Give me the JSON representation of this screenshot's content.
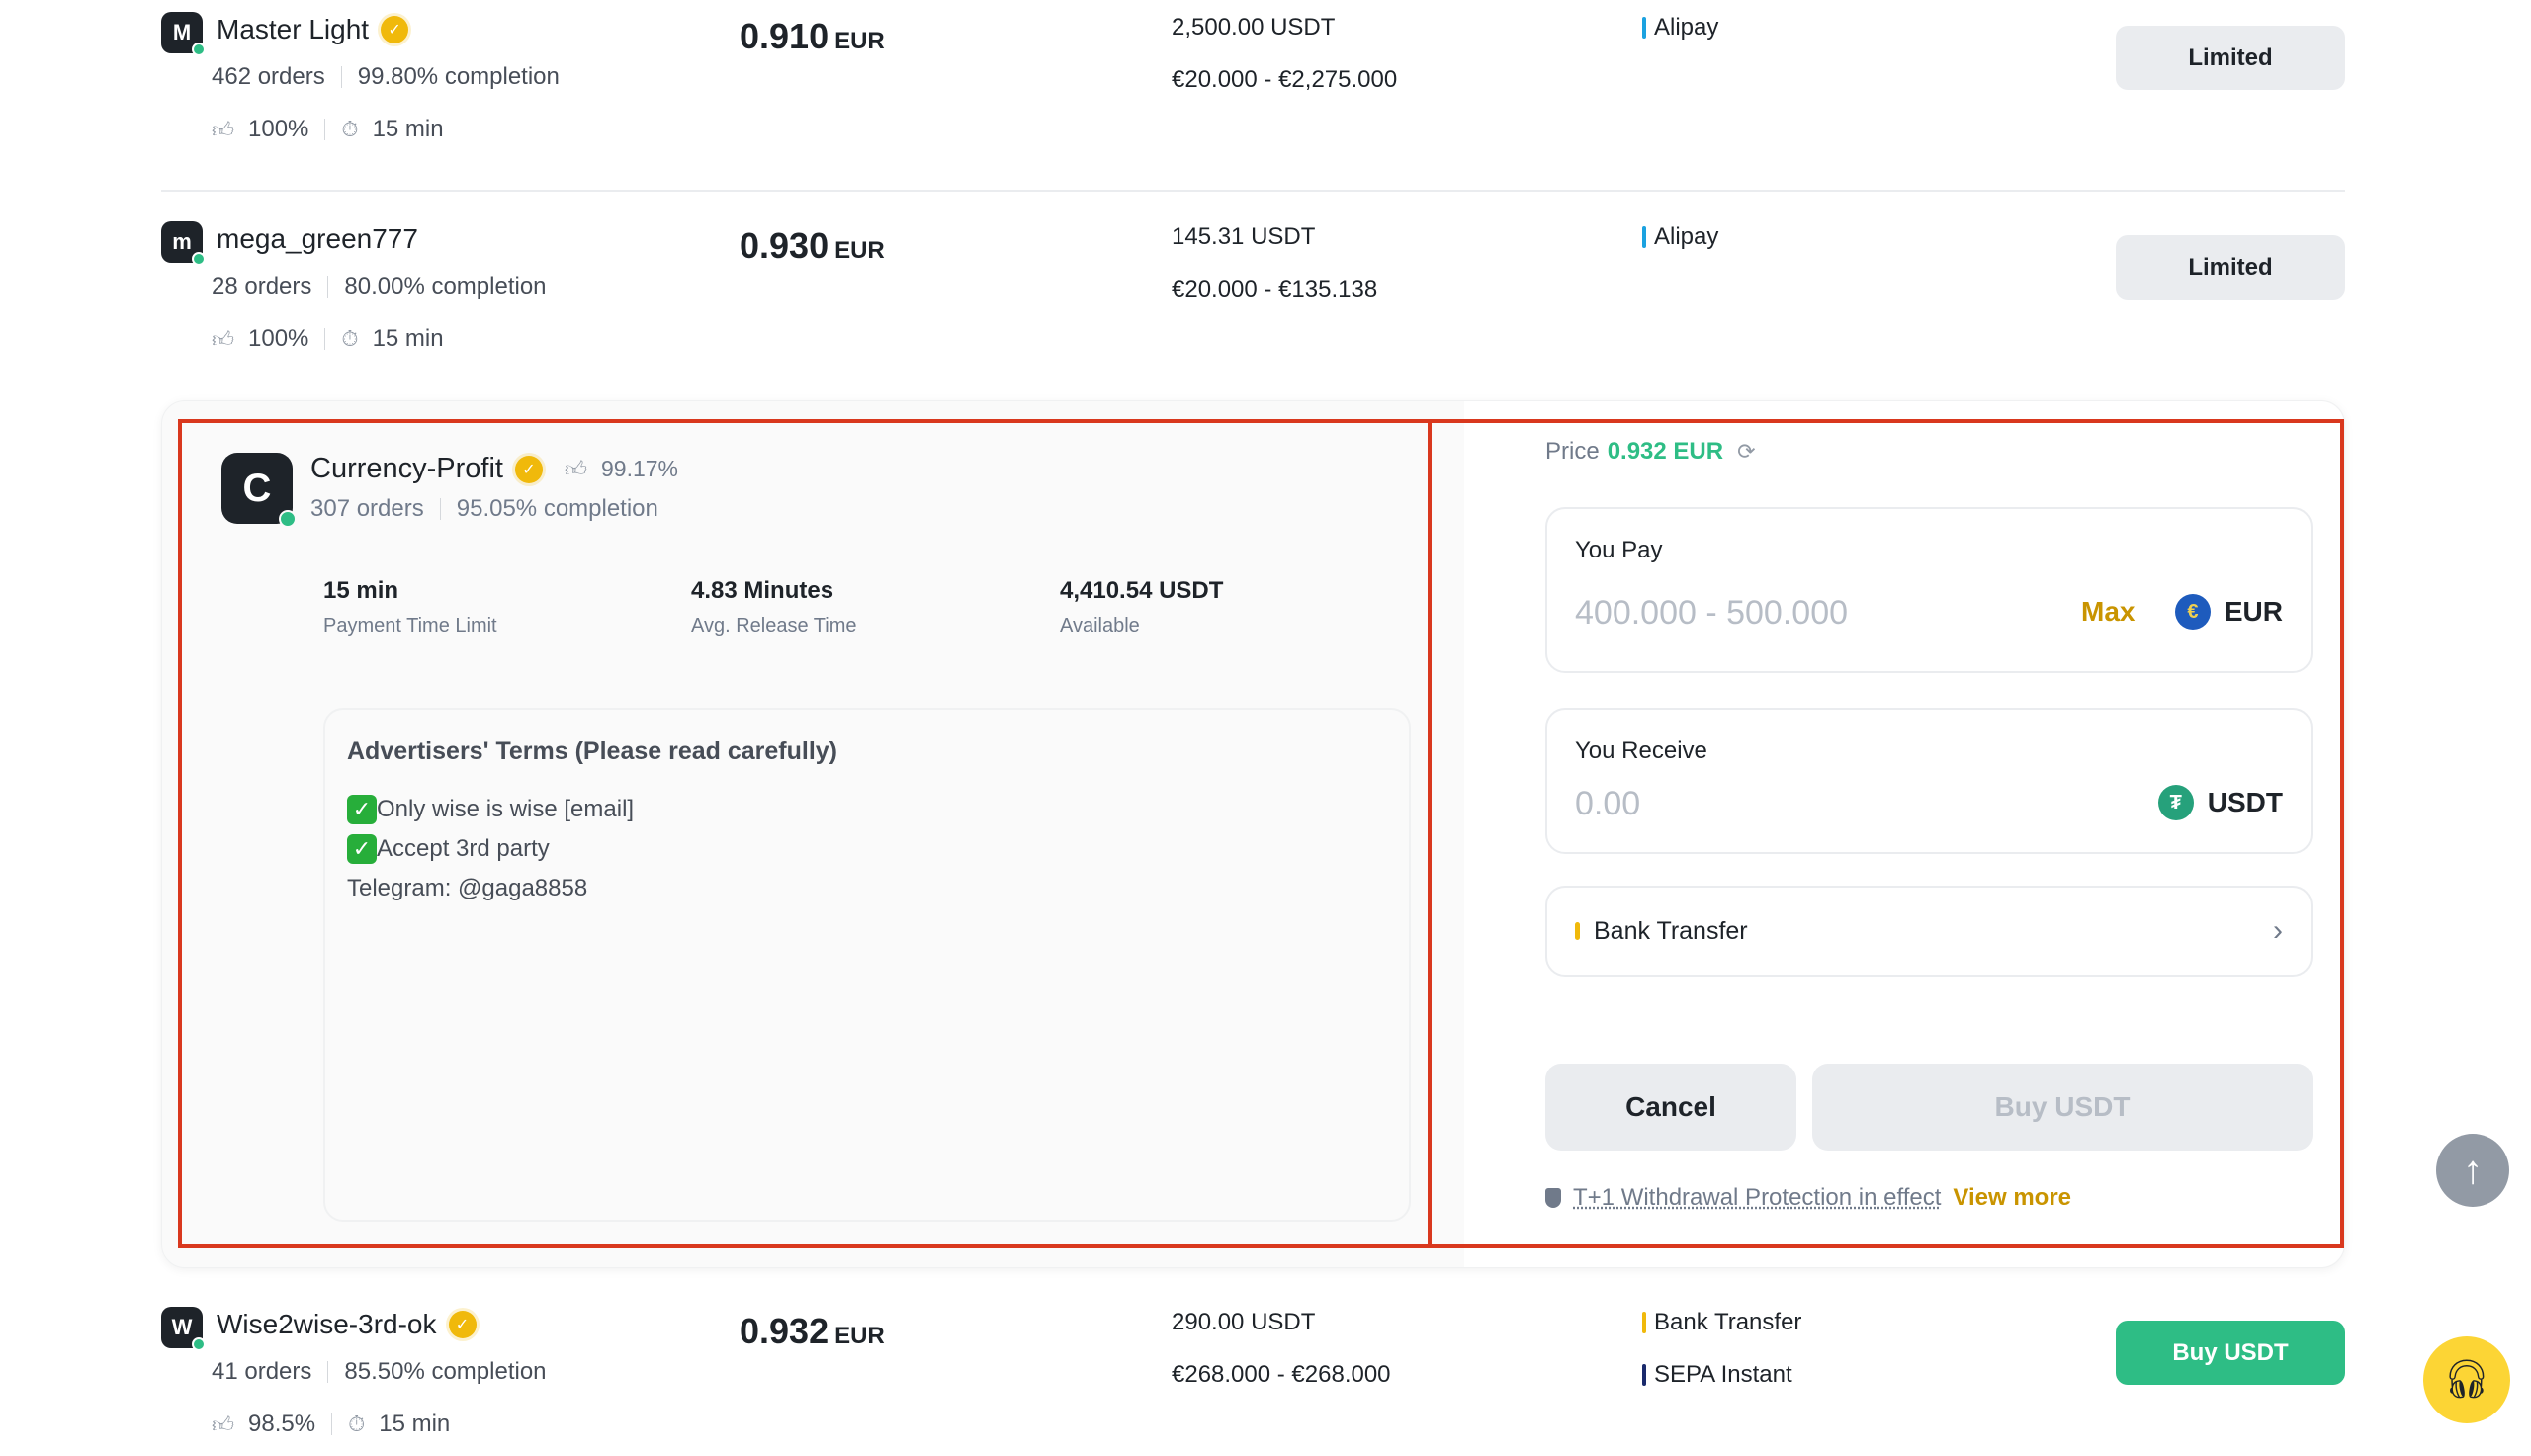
{
  "listings": [
    {
      "avatar_letter": "M",
      "name": "Master Light",
      "verified": true,
      "orders": "462 orders",
      "completion": "99.80% completion",
      "rating": "100%",
      "time_limit": "15 min",
      "price": "0.910",
      "price_currency": "EUR",
      "available": "2,500.00 USDT",
      "limit": "€20.000 - €2,275.000",
      "payment_methods": [
        {
          "label": "Alipay",
          "color": "#1ba2e0"
        }
      ],
      "action_label": "Limited"
    },
    {
      "avatar_letter": "m",
      "name": "mega_green777",
      "verified": false,
      "orders": "28 orders",
      "completion": "80.00% completion",
      "rating": "100%",
      "time_limit": "15 min",
      "price": "0.930",
      "price_currency": "EUR",
      "available": "145.31 USDT",
      "limit": "€20.000 - €135.138",
      "payment_methods": [
        {
          "label": "Alipay",
          "color": "#1ba2e0"
        }
      ],
      "action_label": "Limited"
    },
    {
      "avatar_letter": "W",
      "name": "Wise2wise-3rd-ok",
      "verified": true,
      "orders": "41 orders",
      "completion": "85.50% completion",
      "rating": "98.5%",
      "time_limit": "15 min",
      "price": "0.932",
      "price_currency": "EUR",
      "available": "290.00 USDT",
      "limit": "€268.000 - €268.000",
      "payment_methods": [
        {
          "label": "Bank Transfer",
          "color": "#f0b90b"
        },
        {
          "label": "SEPA Instant",
          "color": "#1a2a6c"
        }
      ],
      "action_label": "Buy USDT"
    }
  ],
  "expanded": {
    "avatar_letter": "C",
    "name": "Currency-Profit",
    "verified": true,
    "rating": "99.17%",
    "orders": "307 orders",
    "completion": "95.05% completion",
    "details": [
      {
        "value": "15 min",
        "label": "Payment Time Limit"
      },
      {
        "value": "4.83 Minutes",
        "label": "Avg. Release Time"
      },
      {
        "value": "4,410.54 USDT",
        "label": "Available"
      }
    ],
    "terms_title": "Advertisers' Terms (Please read carefully)",
    "terms_lines": [
      {
        "check": true,
        "text": "Only wise is wise [email]"
      },
      {
        "check": true,
        "text": "Accept 3rd party"
      },
      {
        "check": false,
        "text": "Telegram: @gaga8858"
      }
    ],
    "order_form": {
      "price_label": "Price",
      "price_value": "0.932 EUR",
      "pay_label": "You Pay",
      "pay_placeholder": "400.000 - 500.000",
      "pay_value": "",
      "max_label": "Max",
      "pay_currency": "EUR",
      "receive_label": "You Receive",
      "receive_placeholder": "0.00",
      "receive_value": "",
      "receive_currency": "USDT",
      "payment_method": "Bank Transfer",
      "cancel_label": "Cancel",
      "buy_label": "Buy USDT",
      "protection_text": "T+1 Withdrawal Protection in effect",
      "view_more_label": "View more"
    }
  },
  "colors": {
    "buy_green": "#2ebd85",
    "brand_yellow": "#f0b90b",
    "link_gold": "#c99400",
    "annotation_red": "#d9381e"
  },
  "icons": {
    "verified": "verified-badge-icon",
    "thumbs_up": "thumbs-up-icon",
    "timer": "stopwatch-icon",
    "refresh": "refresh-icon",
    "chevron": "chevron-right-icon",
    "shield": "shield-icon",
    "scroll_top": "arrow-up-icon",
    "support": "headset-icon"
  }
}
